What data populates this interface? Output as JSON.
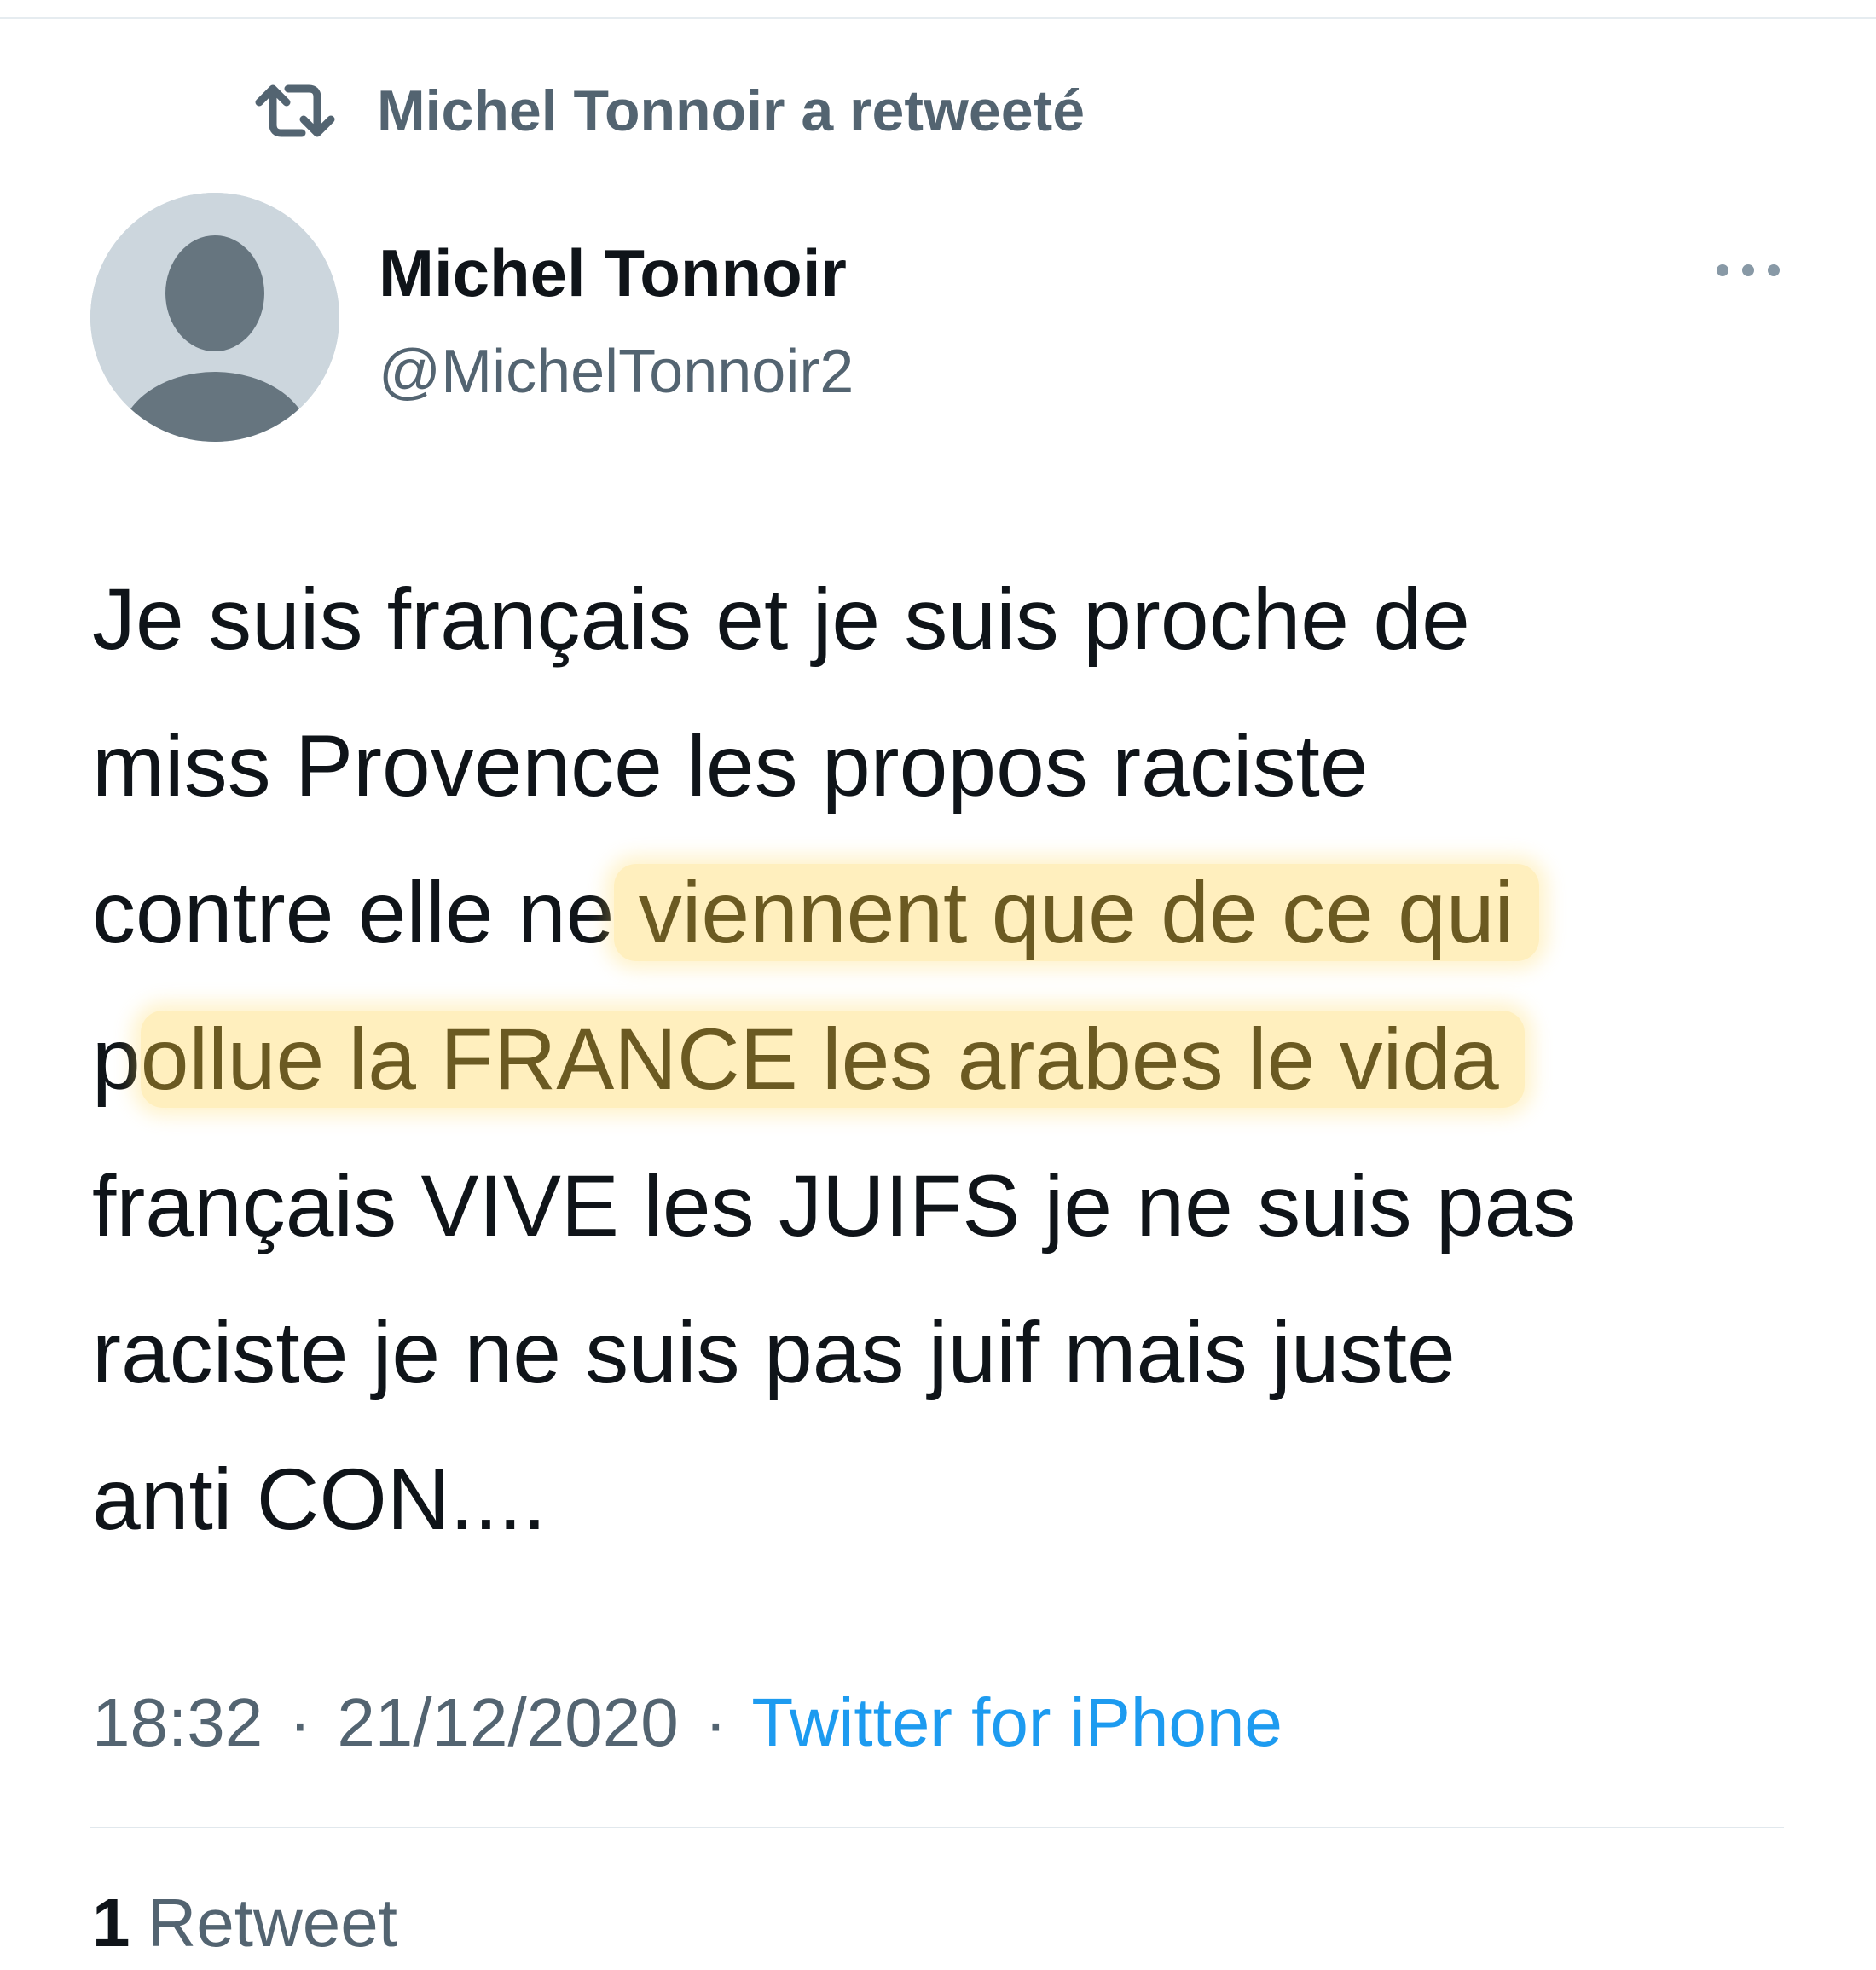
{
  "retweet_context": {
    "icon": "retweet-icon",
    "label": "Michel Tonnoir a retweeté"
  },
  "author": {
    "avatar": "default-avatar",
    "display_name": "Michel Tonnoir",
    "handle": "@MichelTonnoir2"
  },
  "more_menu": {
    "icon": "more-horizontal-icon"
  },
  "tweet": {
    "line1": "Je suis français et je suis proche de",
    "line2": "miss Provence les propos raciste",
    "line3_plain": "contre elle ne",
    "line3_highlight": " viennent que de ce qui",
    "line4_plain": "p",
    "line4_highlight": "ollue la FRANCE les arabes le vida",
    "line5": "français VIVE les JUIFS je ne suis pas",
    "line6": "raciste je ne suis pas juif mais juste",
    "line7": "anti CON....",
    "highlight_color": "#ffda64"
  },
  "meta": {
    "time": "18:32",
    "date": "21/12/2020",
    "separator": "·",
    "source": "Twitter for iPhone",
    "source_color": "#1d9bf0"
  },
  "stats": {
    "retweet_count": "1",
    "retweet_label": "Retweet"
  }
}
